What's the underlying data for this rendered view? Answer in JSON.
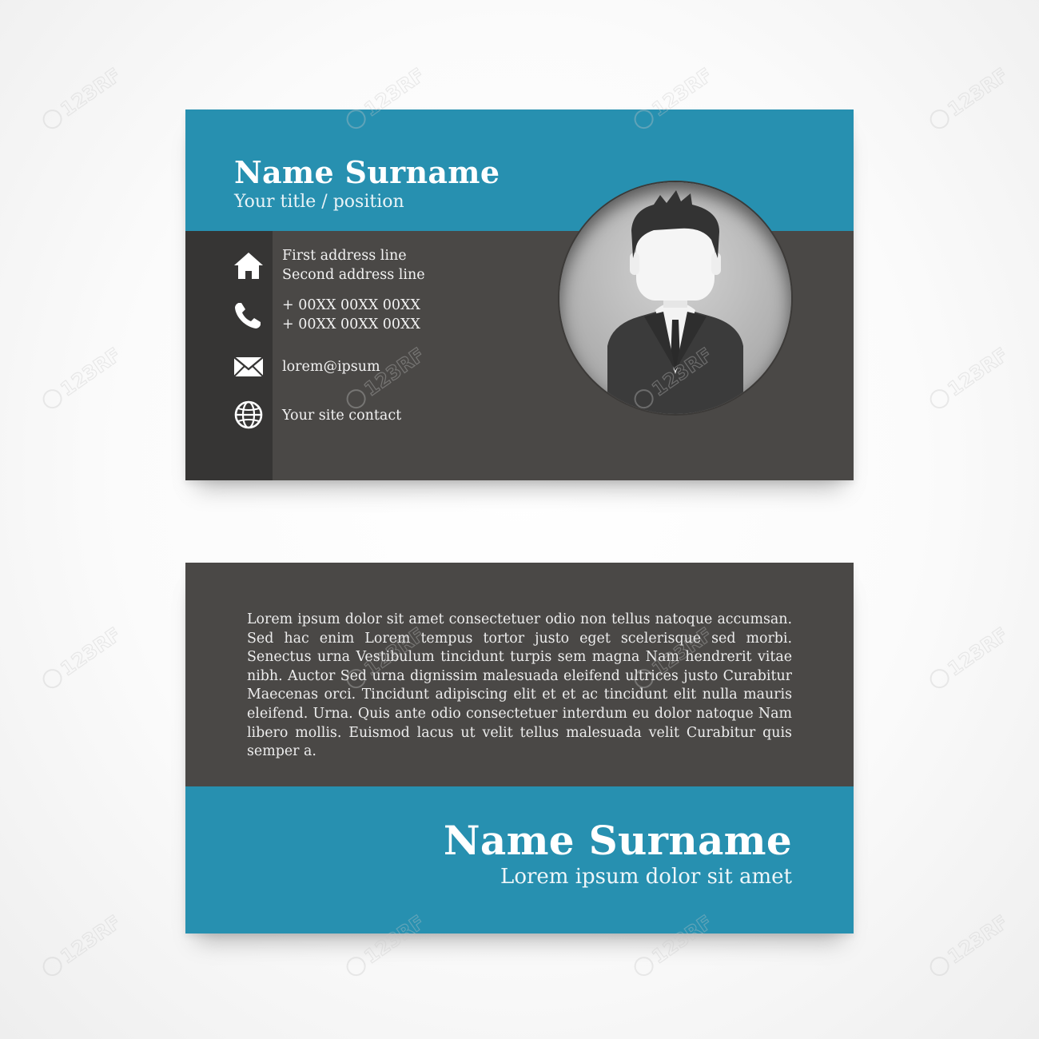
{
  "front": {
    "name": "Name Surname",
    "title": "Your title / position",
    "address_line_1": "First address line",
    "address_line_2": "Second address line",
    "phone_1": "+ 00XX 00XX 00XX",
    "phone_2": "+ 00XX 00XX 00XX",
    "email": "lorem@ipsum",
    "website": "Your site contact",
    "icons": [
      "home-icon",
      "phone-icon",
      "mail-icon",
      "globe-icon"
    ]
  },
  "back": {
    "body": "Lorem ipsum dolor sit amet consectetuer odio non tellus natoque accumsan. Sed hac enim Lorem tempus tortor justo eget scelerisque sed morbi. Senectus urna Vestibulum tincidunt turpis sem magna Nam hendrerit vitae nibh. Auctor Sed urna dignissim malesuada eleifend ultrices justo Curabitur Maecenas orci. Tincidunt adipiscing elit et et ac tincidunt elit nulla mauris eleifend. Urna. Quis ante odio consectetuer interdum eu dolor natoque Nam libero mollis. Euismod lacus ut velit tellus malesuada velit Curabitur quis semper a.",
    "name": "Name Surname",
    "tagline": "Lorem ipsum dolor sit amet"
  },
  "watermark": "123RF",
  "colors": {
    "accent_blue": "#2790b0",
    "card_gray": "#4a4846",
    "sidebar_dark": "#363534",
    "text_white": "#ffffff"
  }
}
